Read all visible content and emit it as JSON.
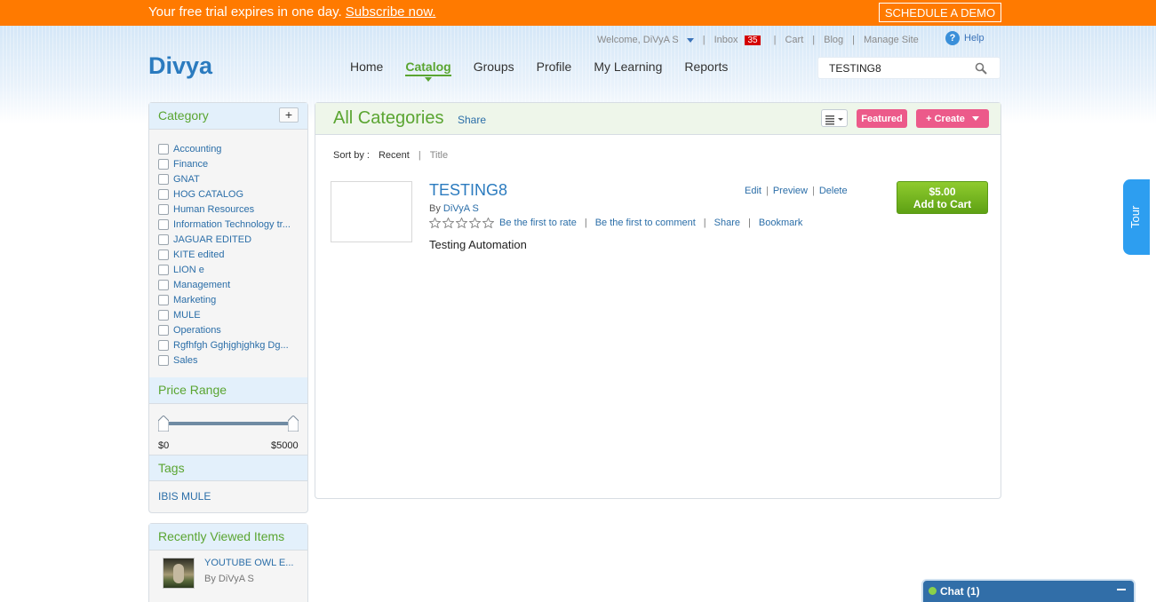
{
  "trial": {
    "message": "Your free trial expires in one day.",
    "subscribe": "Subscribe now.",
    "demo": "SCHEDULE A DEMO"
  },
  "toplinks": {
    "welcome": "Welcome, DiVyA S",
    "inbox": "Inbox",
    "inbox_count": "35",
    "cart": "Cart",
    "blog": "Blog",
    "manage": "Manage Site",
    "help": "Help"
  },
  "logo": "Divya",
  "nav": {
    "home": "Home",
    "catalog": "Catalog",
    "groups": "Groups",
    "profile": "Profile",
    "learning": "My Learning",
    "reports": "Reports"
  },
  "search": {
    "value": "TESTING8"
  },
  "sidebar": {
    "category_title": "Category",
    "plus": "+",
    "categories": [
      "Accounting",
      "Finance",
      "GNAT",
      "HOG CATALOG",
      "Human Resources",
      "Information Technology tr...",
      "JAGUAR EDITED",
      "KITE edited",
      "LION e",
      "Management",
      "Marketing",
      "MULE",
      "Operations",
      "Rgfhfgh Gghjghjghkg Dg...",
      "Sales"
    ],
    "price_title": "Price Range",
    "price_min": "$0",
    "price_max": "$5000",
    "tags_title": "Tags",
    "tag": "IBIS MULE",
    "recent_title": "Recently Viewed Items",
    "recent_item": "YOUTUBE OWL E...",
    "recent_by": "By DiVyA S"
  },
  "main": {
    "title": "All Categories",
    "share": "Share",
    "featured": "Featured",
    "create": "+ Create",
    "sort_label": "Sort by :",
    "sort_recent": "Recent",
    "sort_sep": "|",
    "sort_title": "Title",
    "course": {
      "title": "TESTING8",
      "by": "By",
      "author": "DiVyA S",
      "edit": "Edit",
      "preview": "Preview",
      "delete": "Delete",
      "rate": "Be the first to rate",
      "comment": "Be the first to comment",
      "share": "Share",
      "bookmark": "Bookmark",
      "description": "Testing Automation",
      "price": "$5.00",
      "add_to_cart": "Add to Cart"
    }
  },
  "tour": "Tour",
  "chat": "Chat  (1)"
}
